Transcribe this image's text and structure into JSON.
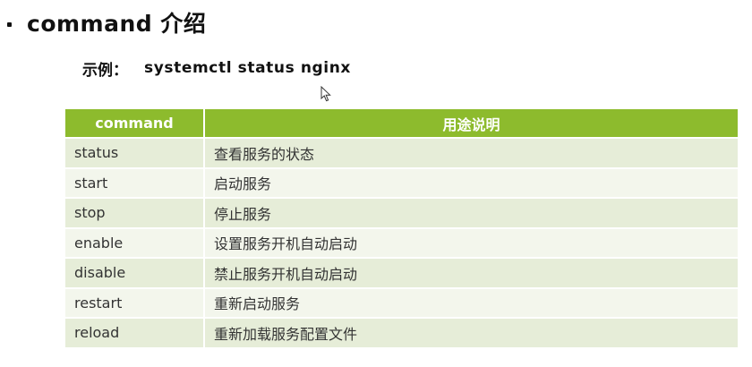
{
  "slide": {
    "title": "command 介绍",
    "example_label": "示例：",
    "example_command": "systemctl status nginx"
  },
  "table": {
    "headers": [
      "command",
      "用途说明"
    ],
    "rows": [
      {
        "command": "status",
        "description": "查看服务的状态"
      },
      {
        "command": "start",
        "description": "启动服务"
      },
      {
        "command": "stop",
        "description": "停止服务"
      },
      {
        "command": "enable",
        "description": "设置服务开机自动启动"
      },
      {
        "command": "disable",
        "description": "禁止服务开机自动启动"
      },
      {
        "command": "restart",
        "description": "重新启动服务"
      },
      {
        "command": "reload",
        "description": "重新加载服务配置文件"
      }
    ]
  },
  "colors": {
    "header_bg": "#8dbb2d",
    "row_odd_bg": "#e6edd8",
    "row_even_bg": "#f3f6ec"
  },
  "icons": {
    "cursor": "mouse-pointer-icon",
    "bullet": "bullet-icon"
  }
}
